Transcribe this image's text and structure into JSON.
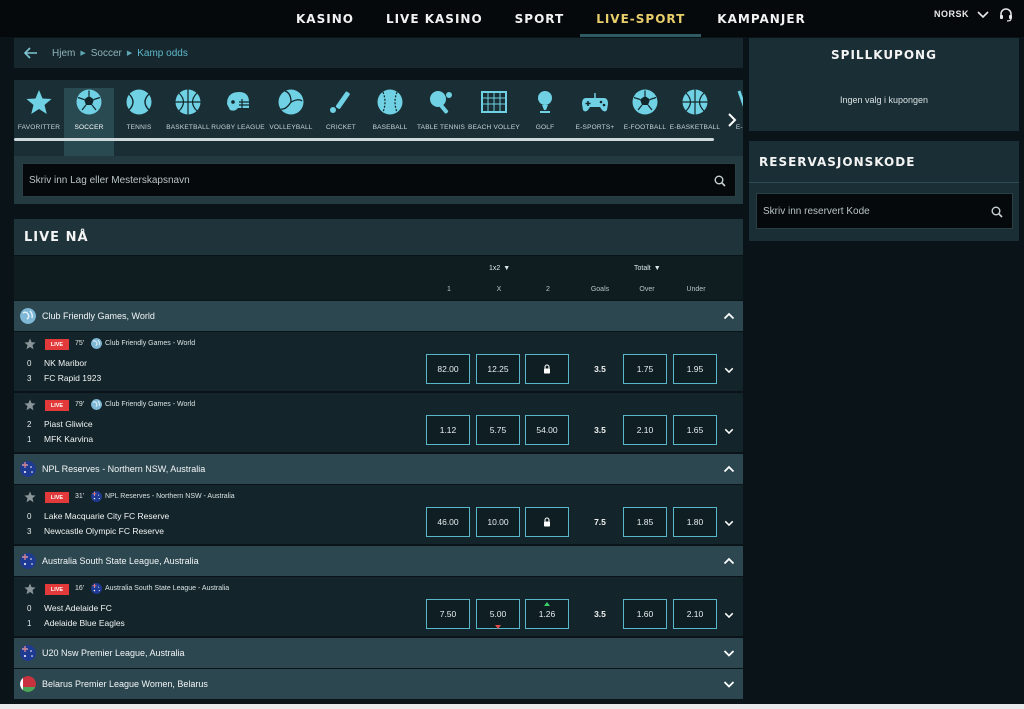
{
  "nav": {
    "items": [
      "KASINO",
      "LIVE KASINO",
      "SPORT",
      "LIVE-SPORT",
      "KAMPANJER"
    ],
    "active_index": 3,
    "language": "NORSK"
  },
  "breadcrumb": [
    "Hjem",
    "Soccer",
    "Kamp odds"
  ],
  "sports": [
    {
      "label": "FAVORITTER",
      "icon": "star-icon"
    },
    {
      "label": "SOCCER",
      "icon": "soccer-ball-icon"
    },
    {
      "label": "TENNIS",
      "icon": "tennis-ball-icon"
    },
    {
      "label": "BASKETBALL",
      "icon": "basketball-icon"
    },
    {
      "label": "RUGBY LEAGUE",
      "icon": "rugby-helmet-icon"
    },
    {
      "label": "VOLLEYBALL",
      "icon": "volleyball-icon"
    },
    {
      "label": "CRICKET",
      "icon": "cricket-bat-icon"
    },
    {
      "label": "BASEBALL",
      "icon": "baseball-icon"
    },
    {
      "label": "TABLE TENNIS",
      "icon": "table-tennis-icon"
    },
    {
      "label": "BEACH VOLLEY",
      "icon": "beach-volley-net-icon"
    },
    {
      "label": "GOLF",
      "icon": "golf-icon"
    },
    {
      "label": "E-SPORTS+",
      "icon": "gamepad-icon"
    },
    {
      "label": "E-FOOTBALL",
      "icon": "soccer-ball-icon"
    },
    {
      "label": "E-BASKETBALL",
      "icon": "basketball-icon"
    },
    {
      "label": "E-ICE",
      "icon": "hockey-icon"
    }
  ],
  "active_sport": 1,
  "search": {
    "placeholder": "Skriv inn Lag eller Mesterskapsnavn"
  },
  "live_title": "LIVE NÅ",
  "columns": {
    "group_1x2": "1x2",
    "group_total": "Totalt",
    "c1": "1",
    "cx": "X",
    "c2": "2",
    "goals": "Goals",
    "over": "Over",
    "under": "Under"
  },
  "leagues": [
    {
      "name": "Club Friendly Games, World",
      "flag": "world",
      "expanded": true,
      "matches": [
        {
          "minute": "75'",
          "competition": "Club Friendly Games",
          "region": "World",
          "home": "NK Maribor",
          "away": "FC Rapid 1923",
          "home_score": "0",
          "away_score": "3",
          "odds": [
            "82.00",
            "12.25",
            "locked"
          ],
          "goals": "3.5",
          "over": "1.75",
          "under": "1.95"
        },
        {
          "minute": "79'",
          "competition": "Club Friendly Games",
          "region": "World",
          "home": "Piast Gliwice",
          "away": "MFK Karvina",
          "home_score": "2",
          "away_score": "1",
          "odds": [
            "1.12",
            "5.75",
            "54.00"
          ],
          "goals": "3.5",
          "over": "2.10",
          "under": "1.65"
        }
      ]
    },
    {
      "name": "NPL Reserves - Northern NSW, Australia",
      "flag": "australia",
      "expanded": true,
      "matches": [
        {
          "minute": "31'",
          "competition": "NPL Reserves - Northern NSW",
          "region": "Australia",
          "home": "Lake Macquarie City FC Reserve",
          "away": "Newcastle Olympic FC Reserve",
          "home_score": "0",
          "away_score": "3",
          "odds": [
            "46.00",
            "10.00",
            "locked"
          ],
          "goals": "7.5",
          "over": "1.85",
          "under": "1.80"
        }
      ]
    },
    {
      "name": "Australia South State League, Australia",
      "flag": "australia",
      "expanded": true,
      "matches": [
        {
          "minute": "16'",
          "competition": "Australia South State League",
          "region": "Australia",
          "home": "West Adelaide FC",
          "away": "Adelaide Blue Eagles",
          "home_score": "0",
          "away_score": "1",
          "odds": [
            "7.50",
            "5.00",
            "1.26"
          ],
          "goals": "3.5",
          "over": "1.60",
          "under": "2.10"
        }
      ]
    },
    {
      "name": "U20 Nsw Premier League, Australia",
      "flag": "australia",
      "expanded": false,
      "matches": []
    },
    {
      "name": "Belarus Premier League Women, Belarus",
      "flag": "belarus",
      "expanded": false,
      "matches": []
    }
  ],
  "live_badge": "LIVE",
  "coupon": {
    "title": "SPILLKUPONG",
    "empty_text": "Ingen valg i kupongen"
  },
  "reservation": {
    "title": "RESERVASJONSKODE",
    "placeholder": "Skriv inn reservert Kode"
  },
  "colors": {
    "accent": "#5fb8cc",
    "gold": "#e9cf6b",
    "live_red": "#e23a3a"
  }
}
